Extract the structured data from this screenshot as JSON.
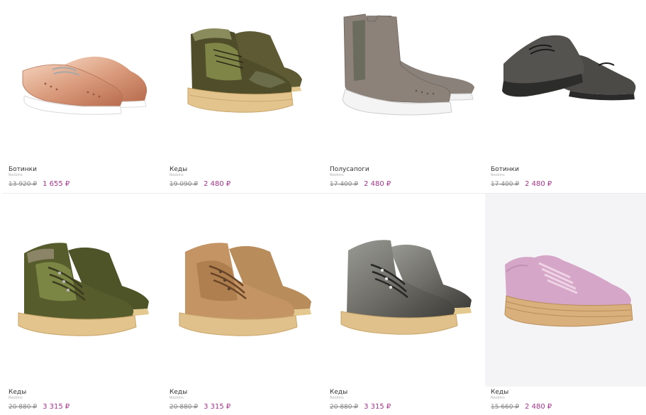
{
  "products": [
    {
      "name": "Ботинки",
      "brand": "Roobins",
      "old_price": "13 920 ₽",
      "new_price": "1 655 ₽",
      "image_icon": "rose-gold-brogue-shoe-icon"
    },
    {
      "name": "Кеды",
      "brand": "Roobins",
      "old_price": "19 090 ₽",
      "new_price": "2 480 ₽",
      "image_icon": "olive-fur-sneaker-icon"
    },
    {
      "name": "Полусапоги",
      "brand": "Roobins",
      "old_price": "17 400 ₽",
      "new_price": "2 480 ₽",
      "image_icon": "grey-chelsea-boot-icon"
    },
    {
      "name": "Ботинки",
      "brand": "Roobins",
      "old_price": "17 400 ₽",
      "new_price": "2 480 ₽",
      "image_icon": "dark-grey-brogue-shoe-icon"
    },
    {
      "name": "Кеды",
      "brand": "Roobins",
      "old_price": "20 880 ₽",
      "new_price": "3 315 ₽",
      "image_icon": "olive-hiking-sneaker-icon"
    },
    {
      "name": "Кеды",
      "brand": "Roobins",
      "old_price": "20 880 ₽",
      "new_price": "3 315 ₽",
      "image_icon": "tan-hiking-sneaker-icon"
    },
    {
      "name": "Кеды",
      "brand": "Roobins",
      "old_price": "20 880 ₽",
      "new_price": "3 315 ₽",
      "image_icon": "metallic-hiking-sneaker-icon"
    },
    {
      "name": "Кеды",
      "brand": "Roobins",
      "old_price": "15 660 ₽",
      "new_price": "2 480 ₽",
      "image_icon": "pink-platform-sneaker-icon"
    }
  ],
  "colors": {
    "sale_price": "#a4348b",
    "old_price": "#888888",
    "divider": "#ececec"
  }
}
